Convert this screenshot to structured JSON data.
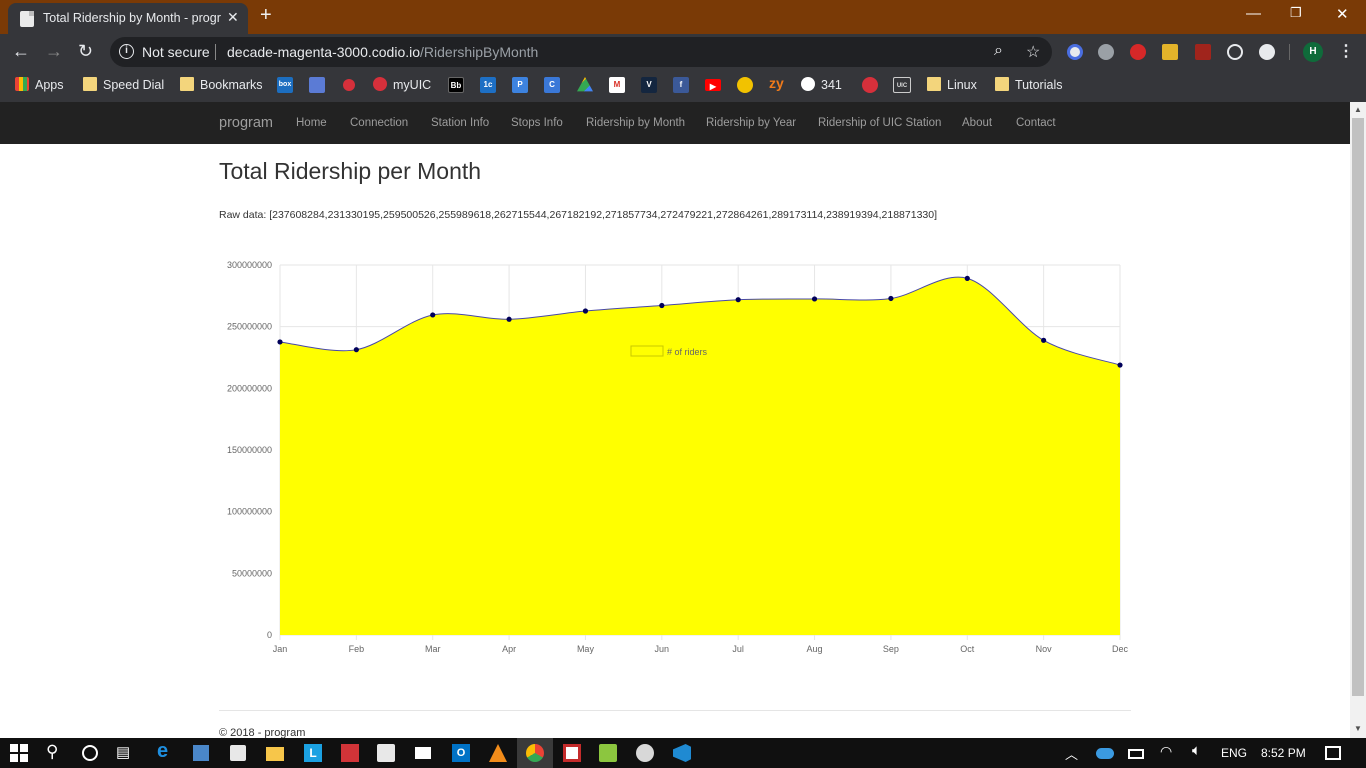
{
  "browser": {
    "tab_title": "Total Ridership by Month - progr",
    "security_label": "Not secure",
    "url_host": "decade-magenta-3000.codio.io",
    "url_path": "/RidershipByMonth",
    "profile_initial": "H"
  },
  "bookmarks": {
    "apps": "Apps",
    "speed_dial": "Speed Dial",
    "bookmarks": "Bookmarks",
    "box": "box",
    "myuic": "myUIC",
    "bb": "Bb",
    "ic": "1c",
    "zy": "zy",
    "n341": "341",
    "uic": "UIC",
    "linux": "Linux",
    "tutorials": "Tutorials"
  },
  "navbar": {
    "brand": "program",
    "links": [
      "Home",
      "Connection",
      "Station Info",
      "Stops Info",
      "Ridership by Month",
      "Ridership by Year",
      "Ridership of UIC Station",
      "About",
      "Contact"
    ]
  },
  "main": {
    "title": "Total Ridership per Month",
    "raw_data_text": "Raw data: [237608284,231330195,259500526,255989618,262715544,267182192,271857734,272479221,272864261,289173114,238919394,218871330]"
  },
  "chart_data": {
    "type": "area",
    "categories": [
      "Jan",
      "Feb",
      "Mar",
      "Apr",
      "May",
      "Jun",
      "Jul",
      "Aug",
      "Sep",
      "Oct",
      "Nov",
      "Dec"
    ],
    "series": [
      {
        "name": "# of riders",
        "values": [
          237608284,
          231330195,
          259500526,
          255989618,
          262715544,
          267182192,
          271857734,
          272479221,
          272864261,
          289173114,
          238919394,
          218871330
        ],
        "fill": "#ffff00",
        "line": "#4848a8",
        "point": "#00005a"
      }
    ],
    "yticks": [
      0,
      50000000,
      100000000,
      150000000,
      200000000,
      250000000,
      300000000
    ],
    "ylim": [
      0,
      300000000
    ],
    "legend": "top-center",
    "grid": true
  },
  "footer": {
    "text": "© 2018 - program"
  },
  "taskbar": {
    "language": "ENG",
    "time": "8:52 PM"
  }
}
